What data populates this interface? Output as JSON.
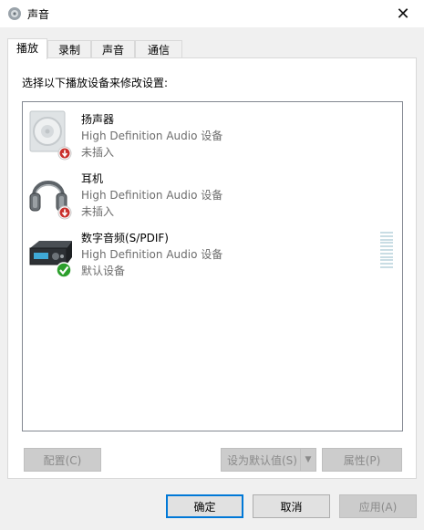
{
  "window": {
    "title": "声音",
    "close_glyph": "✕"
  },
  "tabs": [
    {
      "label": "播放",
      "active": true
    },
    {
      "label": "录制",
      "active": false
    },
    {
      "label": "声音",
      "active": false
    },
    {
      "label": "通信",
      "active": false
    }
  ],
  "instruction": "选择以下播放设备来修改设置:",
  "devices": [
    {
      "name": "扬声器",
      "description": "High Definition Audio 设备",
      "state": "未插入",
      "icon": "speaker-icon",
      "badge": "unplugged-badge"
    },
    {
      "name": "耳机",
      "description": "High Definition Audio 设备",
      "state": "未插入",
      "icon": "headphones-icon",
      "badge": "unplugged-badge"
    },
    {
      "name": "数字音频(S/PDIF)",
      "description": "High Definition Audio 设备",
      "state": "默认设备",
      "icon": "receiver-icon",
      "badge": "default-check-badge"
    }
  ],
  "buttons": {
    "configure": "配置(C)",
    "set_default": "设为默认值(S)",
    "properties": "属性(P)",
    "ok": "确定",
    "cancel": "取消",
    "apply": "应用(A)"
  },
  "colors": {
    "accent": "#0078d7",
    "disabled_text": "#8a8a8a",
    "secondary_text": "#6d6d6d"
  }
}
